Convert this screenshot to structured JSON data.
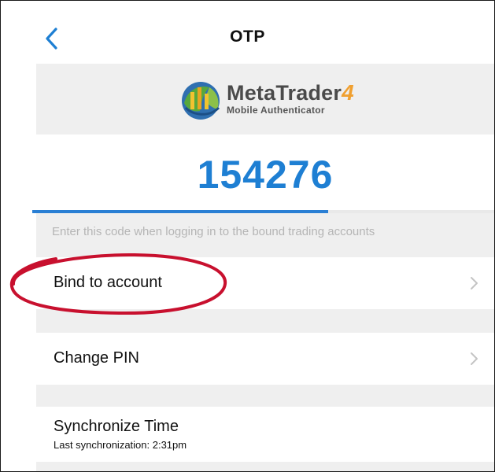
{
  "header": {
    "title": "OTP"
  },
  "logo": {
    "name_main": "MetaTrader",
    "name_number": "4",
    "subtitle": "Mobile Authenticator"
  },
  "otp": {
    "code": "154276",
    "progress_fraction": 0.64,
    "hint": "Enter this code when logging in to the bound trading accounts"
  },
  "menu": {
    "bind": {
      "label": "Bind to account"
    },
    "change_pin": {
      "label": "Change PIN"
    },
    "sync": {
      "label": "Synchronize Time",
      "sub": "Last synchronization: 2:31pm"
    }
  },
  "colors": {
    "accent": "#1e7fd3",
    "annotation": "#c8102e",
    "band": "#efefef"
  },
  "icons": {
    "back": "chevron-left-icon",
    "row_arrow": "chevron-right-icon",
    "logo": "metatrader-logo-icon"
  }
}
